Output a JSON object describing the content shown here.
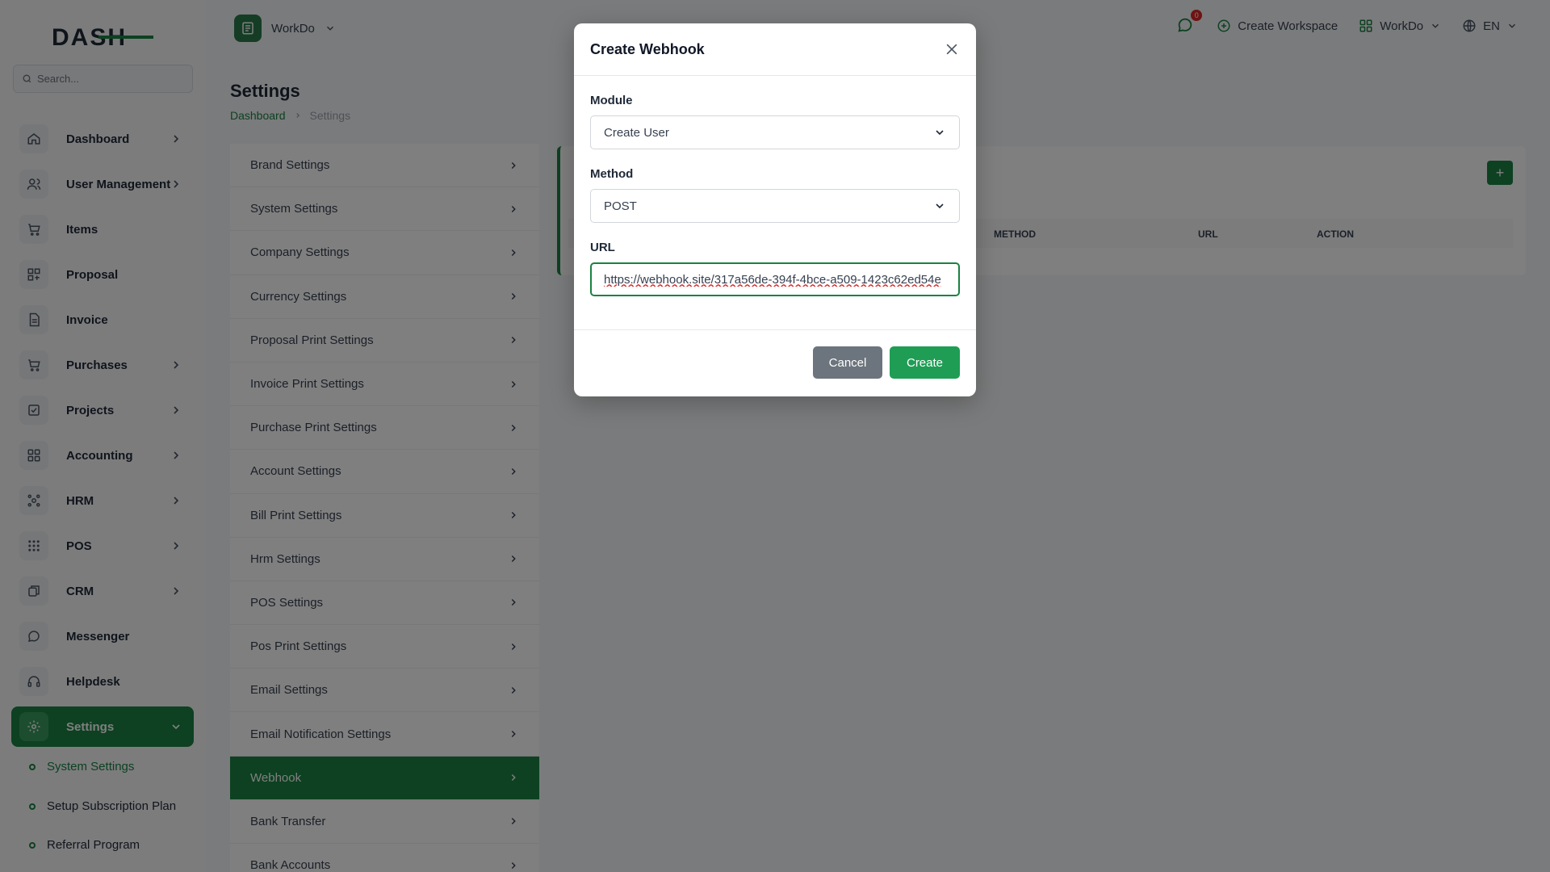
{
  "brand": {
    "logo_text": "DASH",
    "accent": "#1a8243"
  },
  "sidebar": {
    "search_placeholder": "Search...",
    "items": [
      {
        "label": "Dashboard",
        "icon": "home-icon",
        "has_chevron": true
      },
      {
        "label": "User Management",
        "icon": "users-icon",
        "has_chevron": true
      },
      {
        "label": "Items",
        "icon": "cart-icon",
        "has_chevron": false
      },
      {
        "label": "Proposal",
        "icon": "proposal-icon",
        "has_chevron": false
      },
      {
        "label": "Invoice",
        "icon": "invoice-icon",
        "has_chevron": false
      },
      {
        "label": "Purchases",
        "icon": "cart-icon",
        "has_chevron": true
      },
      {
        "label": "Projects",
        "icon": "check-square-icon",
        "has_chevron": true
      },
      {
        "label": "Accounting",
        "icon": "grid-icon",
        "has_chevron": true
      },
      {
        "label": "HRM",
        "icon": "hrm-icon",
        "has_chevron": true
      },
      {
        "label": "POS",
        "icon": "dots-grid-icon",
        "has_chevron": true
      },
      {
        "label": "CRM",
        "icon": "crm-icon",
        "has_chevron": true
      },
      {
        "label": "Messenger",
        "icon": "message-icon",
        "has_chevron": false
      },
      {
        "label": "Helpdesk",
        "icon": "headset-icon",
        "has_chevron": false
      },
      {
        "label": "Settings",
        "icon": "gear-icon",
        "has_chevron": true,
        "active": true
      }
    ],
    "subitems": [
      {
        "label": "System Settings",
        "active": true
      },
      {
        "label": "Setup Subscription Plan"
      },
      {
        "label": "Referral Program"
      }
    ]
  },
  "header": {
    "workspace": "WorkDo",
    "notification_count": "0",
    "create_workspace": "Create Workspace",
    "workspace_menu": "WorkDo",
    "language": "EN"
  },
  "page": {
    "title": "Settings",
    "breadcrumb": {
      "home": "Dashboard",
      "current": "Settings"
    }
  },
  "settings_list": [
    {
      "label": "Brand Settings"
    },
    {
      "label": "System Settings"
    },
    {
      "label": "Company Settings"
    },
    {
      "label": "Currency Settings"
    },
    {
      "label": "Proposal Print Settings"
    },
    {
      "label": "Invoice Print Settings"
    },
    {
      "label": "Purchase Print Settings"
    },
    {
      "label": "Account Settings"
    },
    {
      "label": "Bill Print Settings"
    },
    {
      "label": "Hrm Settings"
    },
    {
      "label": "POS Settings"
    },
    {
      "label": "Pos Print Settings"
    },
    {
      "label": "Email Settings"
    },
    {
      "label": "Email Notification Settings"
    },
    {
      "label": "Webhook",
      "active": true
    },
    {
      "label": "Bank Transfer"
    },
    {
      "label": "Bank Accounts"
    }
  ],
  "webhook_table": {
    "add_button": "+",
    "columns": [
      "METHOD",
      "URL",
      "ACTION"
    ]
  },
  "modal": {
    "title": "Create Webhook",
    "module_label": "Module",
    "module_value": "Create User",
    "method_label": "Method",
    "method_value": "POST",
    "url_label": "URL",
    "url_value": "https://webhook.site/317a56de-394f-4bce-a509-1423c62ed54e",
    "cancel": "Cancel",
    "create": "Create"
  }
}
